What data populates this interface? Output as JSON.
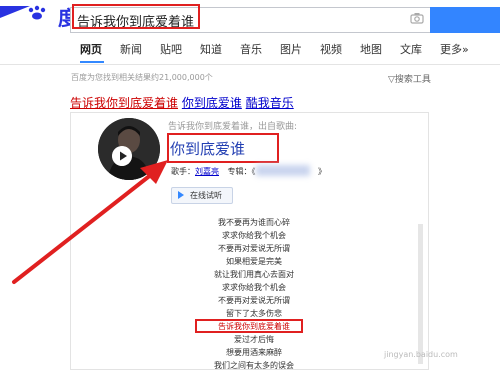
{
  "search": {
    "query": "告诉我你到底爱着谁",
    "logo_char": "度"
  },
  "tabs": [
    "网页",
    "新闻",
    "贴吧",
    "知道",
    "音乐",
    "图片",
    "视频",
    "地图",
    "文库",
    "更多»"
  ],
  "results": {
    "count_text": "百度为您找到相关结果约21,000,000个",
    "tools_label": "搜索工具"
  },
  "top_result": {
    "title_part1": "告诉我你到底爱着谁",
    "title_part2": "你到底爱谁",
    "title_part3": "酷我音乐"
  },
  "card": {
    "subtitle": "告诉我你到底爱着谁，出自歌曲:",
    "song_title": "你到底爱谁",
    "singer_label": "歌手：",
    "singer": "刘嘉亮",
    "album_label": "专辑：《",
    "album_close": "》",
    "listen_label": "在线试听",
    "lyrics": [
      "我不要再为谁而心碎",
      "求求你给我个机会",
      "不要再对爱说无所谓",
      "如果相爱是完美",
      "就让我们用真心去面对",
      "求求你给我个机会",
      "不要再对爱说无所谓",
      "留下了太多伤悲",
      "告诉我你到底爱着谁",
      "爱过才后悔",
      "想要用酒来麻醉",
      "我们之间有太多的误会"
    ],
    "highlight_index": 8,
    "watermark": "jingyan.baidu.com"
  },
  "colors": {
    "accent": "#3385ff",
    "highlight": "#e02020",
    "link": "#0000cc"
  }
}
